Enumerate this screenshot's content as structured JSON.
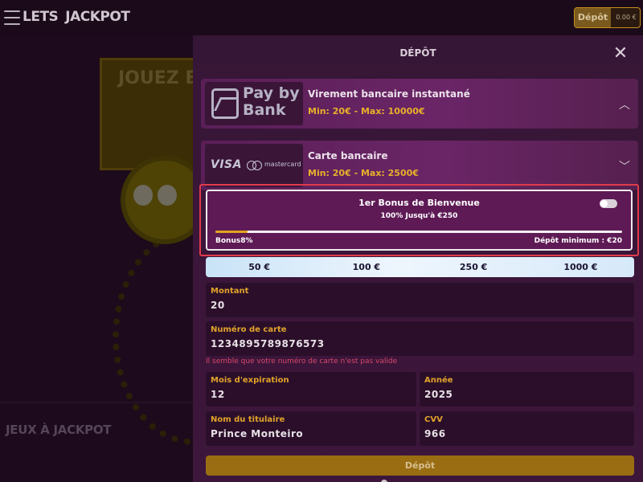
{
  "header": {
    "logo": "LETS JACKPOT",
    "logo_left": "LETS",
    "logo_right": "JACKPOT",
    "deposit_label": "Dépôt",
    "balance": "0.00 €"
  },
  "background": {
    "promo_text": "JOUEZ ET",
    "section_title": "JEUX À JACKPOT"
  },
  "modal": {
    "title": "DÉPÔT",
    "close_icon": "close-icon",
    "methods": [
      {
        "logo_text": "Pay by Bank",
        "logo_line1": "Pay by",
        "logo_line2": "Bank",
        "name": "Virement bancaire instantané",
        "limits": "Min: 20€ - Max: 10000€",
        "expanded": false,
        "chevron": "chevron-up-icon"
      },
      {
        "logo_visa": "VISA",
        "logo_mc": "mastercard",
        "name": "Carte bancaire",
        "limits": "Min: 20€ - Max: 2500€",
        "expanded": true,
        "chevron": "chevron-down-icon"
      }
    ],
    "bonus": {
      "title": "1er Bonus de Bienvenue",
      "subtitle": "100% Jusqu'à €250",
      "toggle_on": false,
      "progress_label": "Bonus8%",
      "progress_fraction": 0.08,
      "min_deposit": "Dépôt minimum : €20",
      "accent": "#e2a41c"
    },
    "amounts": [
      "50 €",
      "100 €",
      "250 €",
      "1000 €"
    ],
    "fields": {
      "amount": {
        "label": "Montant",
        "value": "20"
      },
      "card_number": {
        "label": "Numéro de carte",
        "value": "1234895789876573"
      },
      "card_error": "Il semble que votre numéro de carte n'est pas valide",
      "expiry_month": {
        "label": "Mois d'expiration",
        "value": "12"
      },
      "expiry_year": {
        "label": "Année",
        "value": "2025"
      },
      "holder": {
        "label": "Nom du titulaire",
        "value": "Prince Monteiro"
      },
      "cvv": {
        "label": "CVV",
        "value": "966"
      }
    },
    "submit_label": "Dépôt"
  },
  "colors": {
    "accent_gold": "#e2a32a",
    "error_red": "#d8476a",
    "highlight_border": "#e03b4b",
    "modal_bg": "#3a1639"
  }
}
